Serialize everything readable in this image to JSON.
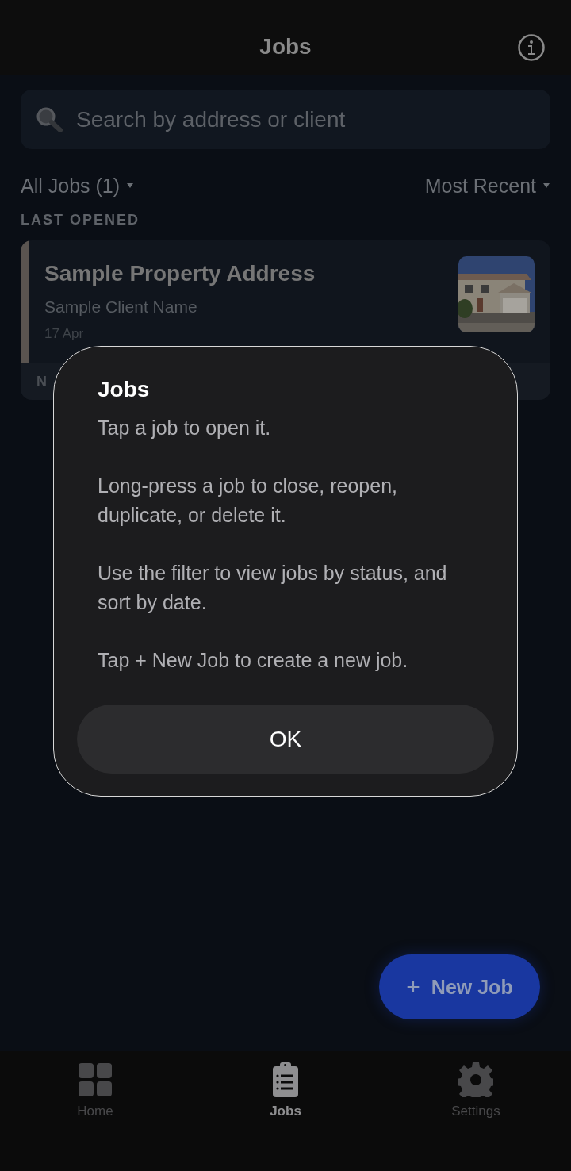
{
  "header": {
    "title": "Jobs"
  },
  "search": {
    "placeholder": "Search by address or client"
  },
  "filter": {
    "label": "All Jobs (1)"
  },
  "sort": {
    "label": "Most Recent"
  },
  "section_title": "LAST OPENED",
  "jobs": [
    {
      "address": "Sample Property Address",
      "client": "Sample Client Name",
      "date": "17 Apr",
      "footer": "N"
    }
  ],
  "dialog": {
    "title": "Jobs",
    "paragraphs": [
      "Tap a job to open it.",
      "Long-press a job to close, reopen, duplicate, or delete it.",
      "Use the filter to view jobs by status, and sort by date.",
      "Tap + New Job to create a new job."
    ],
    "button": "OK"
  },
  "fab": {
    "symbol": "+",
    "label": "New Job"
  },
  "tabs": [
    {
      "label": "Home",
      "selected": false
    },
    {
      "label": "Jobs",
      "selected": true
    },
    {
      "label": "Settings",
      "selected": false
    }
  ]
}
